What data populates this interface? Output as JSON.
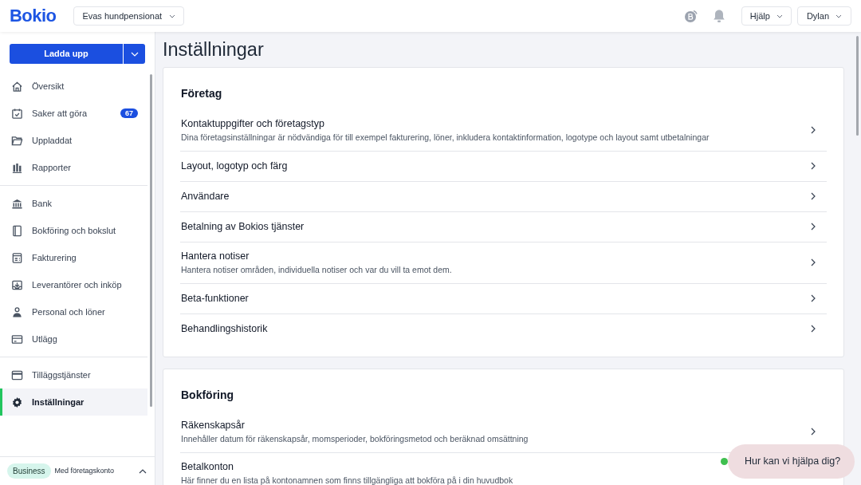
{
  "topbar": {
    "logo": "Bokio",
    "company_selector": "Evas hundpensionat",
    "help_menu": "Hjälp",
    "user_menu": "Dylan"
  },
  "sidebar": {
    "upload_button": "Ladda upp",
    "groups": [
      [
        {
          "label": "Översikt",
          "selected": false
        },
        {
          "label": "Saker att göra",
          "selected": false,
          "badge": "67"
        },
        {
          "label": "Uppladdat",
          "selected": false
        },
        {
          "label": "Rapporter",
          "selected": false
        }
      ],
      [
        {
          "label": "Bank",
          "selected": false
        },
        {
          "label": "Bokföring och bokslut",
          "selected": false
        },
        {
          "label": "Fakturering",
          "selected": false
        },
        {
          "label": "Leverantörer och inköp",
          "selected": false
        },
        {
          "label": "Personal och löner",
          "selected": false
        },
        {
          "label": "Utlägg",
          "selected": false
        }
      ],
      [
        {
          "label": "Tilläggstjänster",
          "selected": false
        },
        {
          "label": "Inställningar",
          "selected": true
        }
      ]
    ],
    "plan": {
      "badge": "Business",
      "label": "Med företagskonto"
    }
  },
  "page": {
    "title": "Inställningar",
    "sections": [
      {
        "title": "Företag",
        "rows": [
          {
            "title": "Kontaktuppgifter och företagstyp",
            "description": "Dina företagsinställningar är nödvändiga för till exempel fakturering, löner, inkludera kontaktinformation, logotype och layout samt utbetalningar"
          },
          {
            "title": "Layout, logotyp och färg"
          },
          {
            "title": "Användare"
          },
          {
            "title": "Betalning av Bokios tjänster"
          },
          {
            "title": "Hantera notiser",
            "description": "Hantera notiser områden, individuella notiser och var du vill ta emot dem."
          },
          {
            "title": "Beta-funktioner"
          },
          {
            "title": "Behandlingshistorik"
          }
        ]
      },
      {
        "title": "Bokföring",
        "rows": [
          {
            "title": "Räkenskapsår",
            "description": "Innehåller datum för räkenskapsår, momsperioder, bokföringsmetod och beräknad omsättning"
          },
          {
            "title": "Betalkonton",
            "description": "Här finner du en lista på kontonamnen som finns tillgängliga att bokföra på i din huvudbok"
          }
        ]
      }
    ]
  },
  "chat": {
    "label": "Hur kan vi hjälpa dig?",
    "online": true
  }
}
